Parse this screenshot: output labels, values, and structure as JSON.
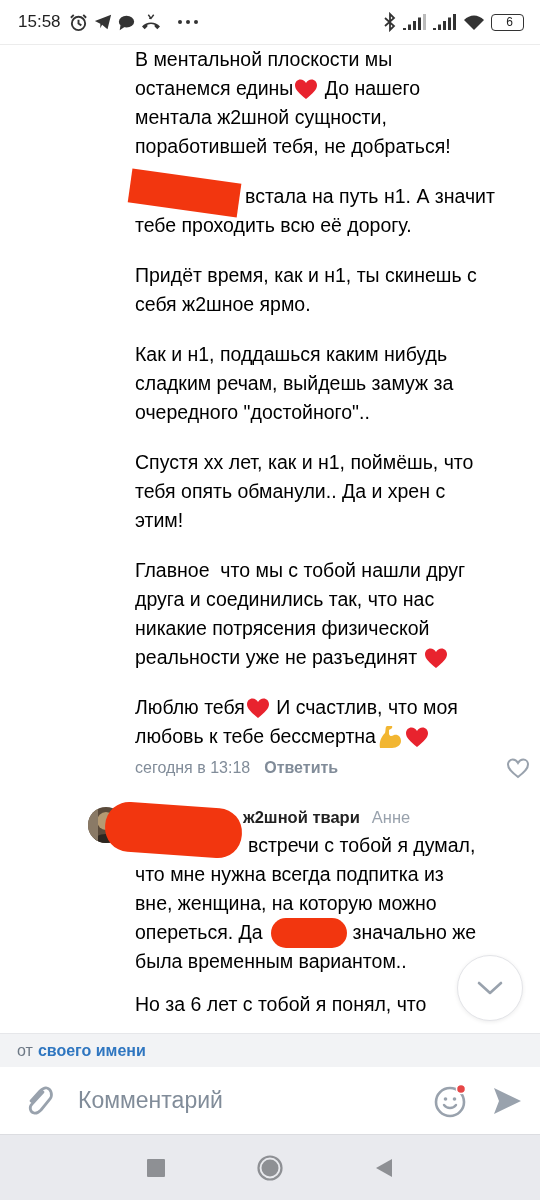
{
  "status_bar": {
    "time": "15:58",
    "battery": "6"
  },
  "comments": [
    {
      "paragraphs": [
        [
          [
            {
              "kind": "text",
              "text": "В ментальной плоскости мы"
            }
          ],
          [
            {
              "kind": "text",
              "text": "останемся едины"
            },
            {
              "kind": "heart"
            },
            {
              "kind": "text",
              "text": " До нашего"
            }
          ],
          [
            {
              "kind": "text",
              "text": "ментала ж2шной сущности,"
            }
          ],
          [
            {
              "kind": "text",
              "text": "поработившей тебя, не добраться!"
            }
          ]
        ],
        [
          [
            {
              "kind": "redaction"
            },
            {
              "kind": "text",
              "text": "встала на путь н1. А значит"
            }
          ],
          [
            {
              "kind": "text",
              "text": "тебе проходить всю её дорогу."
            }
          ]
        ],
        [
          [
            {
              "kind": "text",
              "text": "Придёт время, как и н1, ты скинешь с"
            }
          ],
          [
            {
              "kind": "text",
              "text": "себя ж2шное ярмо."
            }
          ]
        ],
        [
          [
            {
              "kind": "text",
              "text": "Как и н1, поддашься каким нибудь"
            }
          ],
          [
            {
              "kind": "text",
              "text": "сладким речам, выйдешь замуж за"
            }
          ],
          [
            {
              "kind": "text",
              "text": "очередного \"достойного\".."
            }
          ]
        ],
        [
          [
            {
              "kind": "text",
              "text": "Спустя хх лет, как и н1, поймёшь, что"
            }
          ],
          [
            {
              "kind": "text",
              "text": "тебя опять обманули.. Да и хрен с"
            }
          ],
          [
            {
              "kind": "text",
              "text": "этим!"
            }
          ]
        ],
        [
          [
            {
              "kind": "text",
              "text": "Главное  что мы с тобой нашли друг"
            }
          ],
          [
            {
              "kind": "text",
              "text": "друга и соединились так, что нас"
            }
          ],
          [
            {
              "kind": "text",
              "text": "никакие потрясения физической"
            }
          ],
          [
            {
              "kind": "text",
              "text": "реальности уже не разъединят "
            },
            {
              "kind": "heart"
            }
          ]
        ],
        [
          [
            {
              "kind": "text",
              "text": "Люблю тебя"
            },
            {
              "kind": "heart"
            },
            {
              "kind": "text",
              "text": " И счастлив, что моя"
            }
          ],
          [
            {
              "kind": "text",
              "text": "любовь к тебе бессмертна"
            },
            {
              "kind": "flex"
            },
            {
              "kind": "heart"
            }
          ]
        ]
      ],
      "date": "сегодня в 13:18",
      "reply": "Ответить",
      "liked": false
    },
    {
      "avatar": {
        "kind": "picture"
      },
      "header_redacted": true,
      "author": "ж2шной твари",
      "reply_to": "Анне",
      "paragraphs": [
        [
          [
            {
              "kind": "text",
              "text": "встречи с тобой я думал,"
            }
          ],
          [
            {
              "kind": "text",
              "text": "что мне нужна всегда подпитка из"
            }
          ],
          [
            {
              "kind": "text",
              "text": "вне, женщина, на которую можно"
            }
          ],
          [
            {
              "kind": "text",
              "text": "опереться. Да"
            },
            {
              "kind": "redaction"
            },
            {
              "kind": "text",
              "text": "значально же"
            }
          ],
          [
            {
              "kind": "text",
              "text": "была временным вариантом.."
            }
          ]
        ],
        [
          [
            {
              "kind": "text",
              "text": "Но за 6 лет с тобой я понял, что"
            }
          ]
        ]
      ]
    }
  ],
  "signature": {
    "prefix": "от",
    "link": "своего имени"
  },
  "composer": {
    "placeholder": "Комментарий",
    "emoji_badge": true
  }
}
